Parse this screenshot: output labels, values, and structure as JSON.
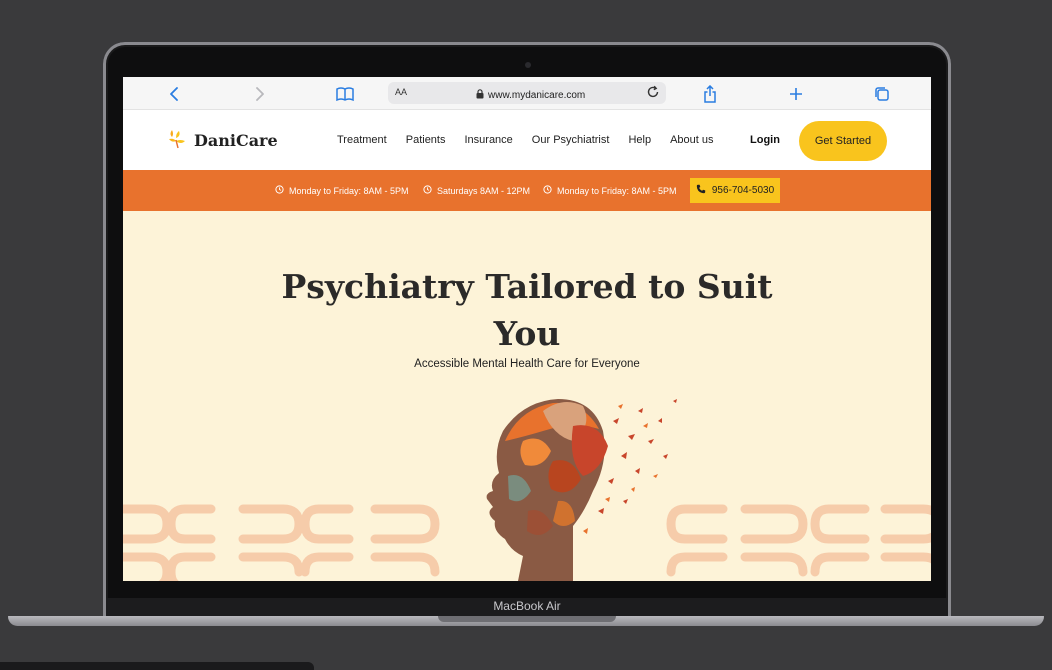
{
  "browser": {
    "text_size_label": "AA",
    "url": "www.mydanicare.com",
    "icons": [
      "back-icon",
      "forward-icon",
      "bookmarks-icon",
      "lock-icon",
      "reload-icon",
      "share-icon",
      "new-tab-icon",
      "tabs-icon"
    ]
  },
  "site": {
    "brand": "DaniCare",
    "nav": [
      "Treatment",
      "Patients",
      "Insurance",
      "Our Psychiatrist",
      "Help",
      "About us"
    ],
    "login_label": "Login",
    "cta_label": "Get Started"
  },
  "hours": {
    "items": [
      "Monday to Friday: 8AM - 5PM",
      "Saturdays 8AM - 12PM",
      "Monday to Friday: 8AM - 5PM"
    ],
    "phone": "956-704-5030"
  },
  "hero": {
    "title": "Psychiatry Tailored to Suit You",
    "subtitle": "Accessible Mental Health Care for Everyone"
  },
  "device_label": "MacBook Air",
  "colors": {
    "accent_orange": "#e8722d",
    "accent_yellow": "#f9c41d",
    "hero_background": "#fdf3d8",
    "browser_link_blue": "#2a7de1"
  }
}
